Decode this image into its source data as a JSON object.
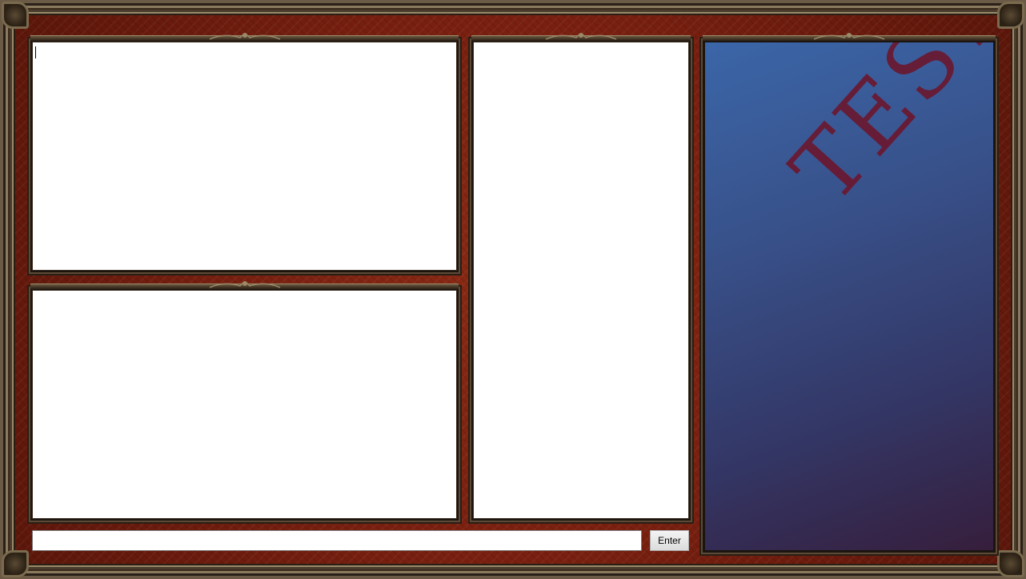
{
  "panels": {
    "log_top_left": {
      "text": ""
    },
    "log_bottom_left": {
      "text": ""
    },
    "list_middle": {
      "text": ""
    }
  },
  "art": {
    "watermark": "TEST",
    "gradient_top": "#3b66a8",
    "gradient_bottom": "#361e3c",
    "watermark_color": "#6a1830"
  },
  "input": {
    "value": "",
    "placeholder": ""
  },
  "enter_button": {
    "label": "Enter"
  },
  "theme": {
    "background": "#7a2010",
    "frame": "#5c4a36"
  }
}
